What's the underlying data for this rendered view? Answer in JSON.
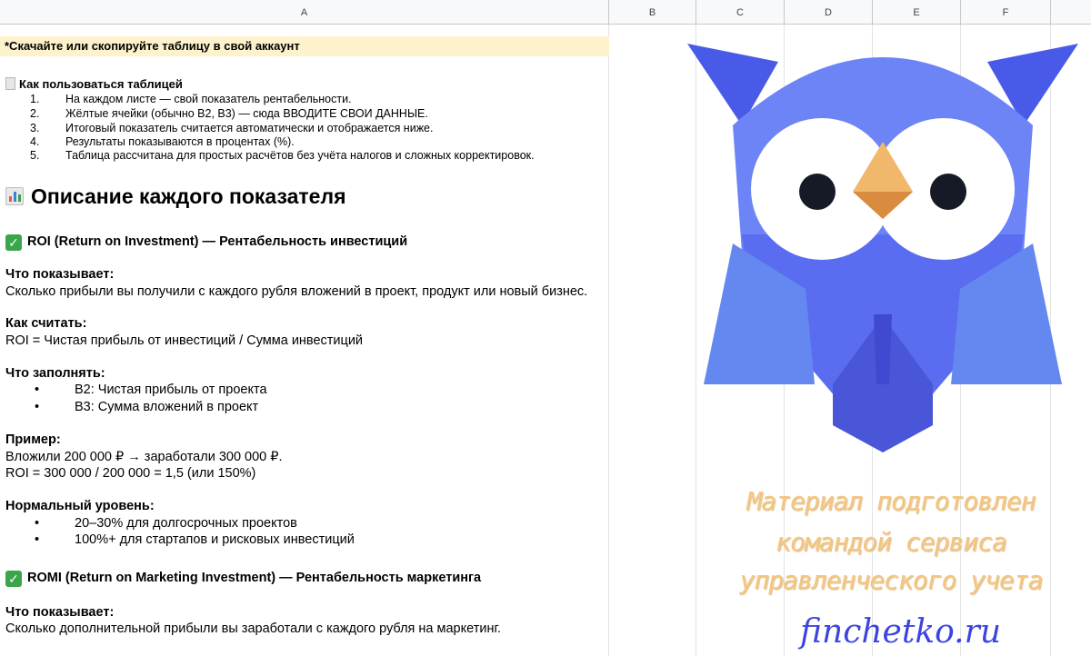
{
  "columns": [
    "A",
    "B",
    "C",
    "D",
    "E",
    "F"
  ],
  "note": "*Скачайте или скопируйте таблицу в свой аккаунт",
  "howto": {
    "title": "Как пользоваться таблицей",
    "steps": [
      {
        "num": "1.",
        "text": "На каждом листе — свой показатель рентабельности."
      },
      {
        "num": "2.",
        "text": "Жёлтые ячейки (обычно B2, B3) — сюда ВВОДИТЕ СВОИ ДАННЫЕ."
      },
      {
        "num": "3.",
        "text": "Итоговый показатель считается автоматически и отображается ниже."
      },
      {
        "num": "4.",
        "text": "Результаты показываются в процентах (%)."
      },
      {
        "num": "5.",
        "text": "Таблица рассчитана для простых расчётов без учёта налогов и сложных корректировок."
      }
    ]
  },
  "section_title": "Описание каждого показателя",
  "roi": {
    "title": "ROI (Return on Investment) — Рентабельность инвестиций",
    "what_label": "Что показывает:",
    "what_text": "Сколько прибыли вы получили с каждого рубля вложений в проект, продукт или новый бизнес.",
    "how_label": "Как считать:",
    "how_text": "ROI = Чистая прибыль от инвестиций / Сумма инвестиций",
    "fill_label": "Что заполнять:",
    "fill_items": [
      "B2: Чистая прибыль от проекта",
      "B3: Сумма вложений в проект"
    ],
    "example_label": "Пример:",
    "example_line1": "Вложили 200 000 ₽ → заработали 300 000 ₽.",
    "example_line2": "ROI = 300 000 / 200 000 = 1,5 (или 150%)",
    "norm_label": "Нормальный уровень:",
    "norm_items": [
      "20–30% для долгосрочных проектов",
      "100%+ для стартапов и рисковых инвестиций"
    ]
  },
  "romi": {
    "title": "ROMI (Return on Marketing Investment) — Рентабельность маркетинга",
    "what_label": "Что показывает:",
    "what_text": "Сколько дополнительной прибыли вы заработали с каждого рубля на маркетинг."
  },
  "promo": {
    "line1": "Материал подготовлен",
    "line2": "командой сервиса",
    "line3": "управленческого учета",
    "site": "finchetko.ru"
  },
  "icons": {
    "doc": "page-icon",
    "chart": "bar-chart-icon",
    "check": "check-mark-icon",
    "logo": "owl-logo"
  },
  "colors": {
    "note_bg": "#fdf2cc",
    "check_green": "#3aa64a",
    "owl_blue": "#5a6cf0",
    "promo_text": "#f4c57e",
    "site_text": "#3b44e0"
  }
}
